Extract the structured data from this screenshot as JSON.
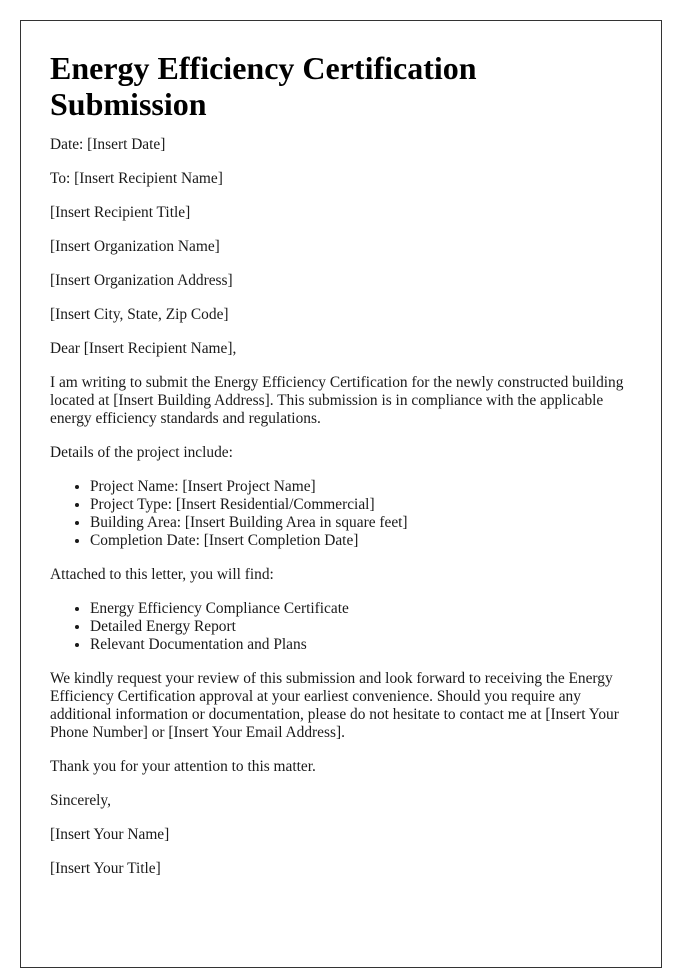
{
  "document": {
    "title": "Energy Efficiency Certification Submission",
    "header_lines": [
      "Date: [Insert Date]",
      "To: [Insert Recipient Name]",
      "[Insert Recipient Title]",
      "[Insert Organization Name]",
      "[Insert Organization Address]",
      "[Insert City, State, Zip Code]"
    ],
    "salutation": "Dear [Insert Recipient Name],",
    "intro_paragraph": "I am writing to submit the Energy Efficiency Certification for the newly constructed building located at [Insert Building Address]. This submission is in compliance with the applicable energy efficiency standards and regulations.",
    "details_heading": "Details of the project include:",
    "details_items": [
      "Project Name: [Insert Project Name]",
      "Project Type: [Insert Residential/Commercial]",
      "Building Area: [Insert Building Area in square feet]",
      "Completion Date: [Insert Completion Date]"
    ],
    "attachments_heading": "Attached to this letter, you will find:",
    "attachments_items": [
      "Energy Efficiency Compliance Certificate",
      "Detailed Energy Report",
      "Relevant Documentation and Plans"
    ],
    "request_paragraph": "We kindly request your review of this submission and look forward to receiving the Energy Efficiency Certification approval at your earliest convenience. Should you require any additional information or documentation, please do not hesitate to contact me at [Insert Your Phone Number] or [Insert Your Email Address].",
    "thanks": "Thank you for your attention to this matter.",
    "closing": "Sincerely,",
    "signature_name": "[Insert Your Name]",
    "signature_title": "[Insert Your Title]"
  }
}
